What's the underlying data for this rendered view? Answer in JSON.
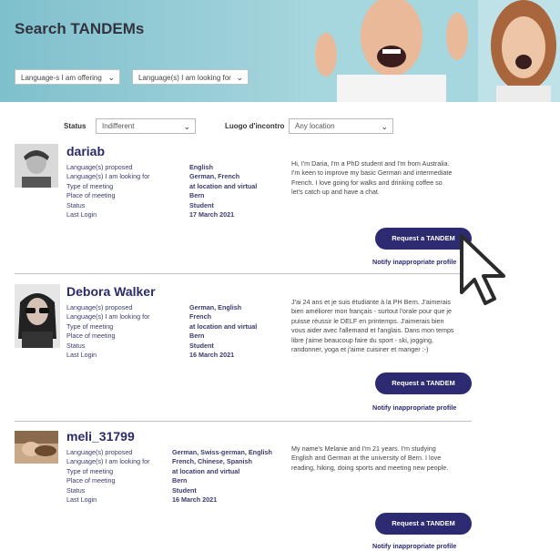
{
  "header": {
    "title": "Search TANDEMs",
    "offering_select": "Language-s I am offering",
    "looking_select": "Language(s) I am looking for"
  },
  "filters": {
    "status_label": "Status",
    "status_value": "Indifferent",
    "meeting_label": "Luogo d'incontro",
    "meeting_value": "Any location"
  },
  "field_labels": [
    "Language(s) proposed",
    "Language(s) I am looking for",
    "Type of meeting",
    "Place of meeting",
    "Status",
    "Last Login"
  ],
  "profiles": [
    {
      "name": "dariab",
      "values": [
        "English",
        "German, French",
        "at location and virtual",
        "Bern",
        "Student",
        "17 March 2021"
      ],
      "bio": "Hi, I'm Daria, I'm a PhD student and I'm from Australia. I'm keen to improve my basic German and intermediate French. I love going for walks and drinking coffee so let's catch up and have a chat.",
      "request_label": "Request a TANDEM",
      "notify_label": "Notify inappropriate profile"
    },
    {
      "name": "Debora Walker",
      "values": [
        "German, English",
        "French",
        "at location and virtual",
        "Bern",
        "Student",
        "16 March 2021"
      ],
      "bio": "J'ai 24 ans et je suis étudiante à la PH Bern. J'aimerais bien améliorer mon français - surtout l'orale pour que je puisse réussir le DELF en printemps. J'aimerais bien vous aider avec l'allemand et l'anglais. Dans mon temps libre j'aime beaucoup faire du sport - ski, jogging, randonner, yoga et j'aime cuisiner et manger :-)",
      "request_label": "Request a TANDEM",
      "notify_label": "Notify inappropriate profile"
    },
    {
      "name": "meli_31799",
      "values": [
        "German, Swiss-german, English",
        "French, Chinese, Spanish",
        "at location and virtual",
        "Bern",
        "Student",
        "16 March 2021"
      ],
      "bio": "My name's Melanie and I'm 21 years. I'm studying English and German at the university of Bern. I love reading, hiking, doing sports and meeting new people.",
      "request_label": "Request a TANDEM",
      "notify_label": "Notify inappropriate profile"
    }
  ],
  "colors": {
    "accent": "#2c2a70",
    "banner": "#9fd1da"
  }
}
